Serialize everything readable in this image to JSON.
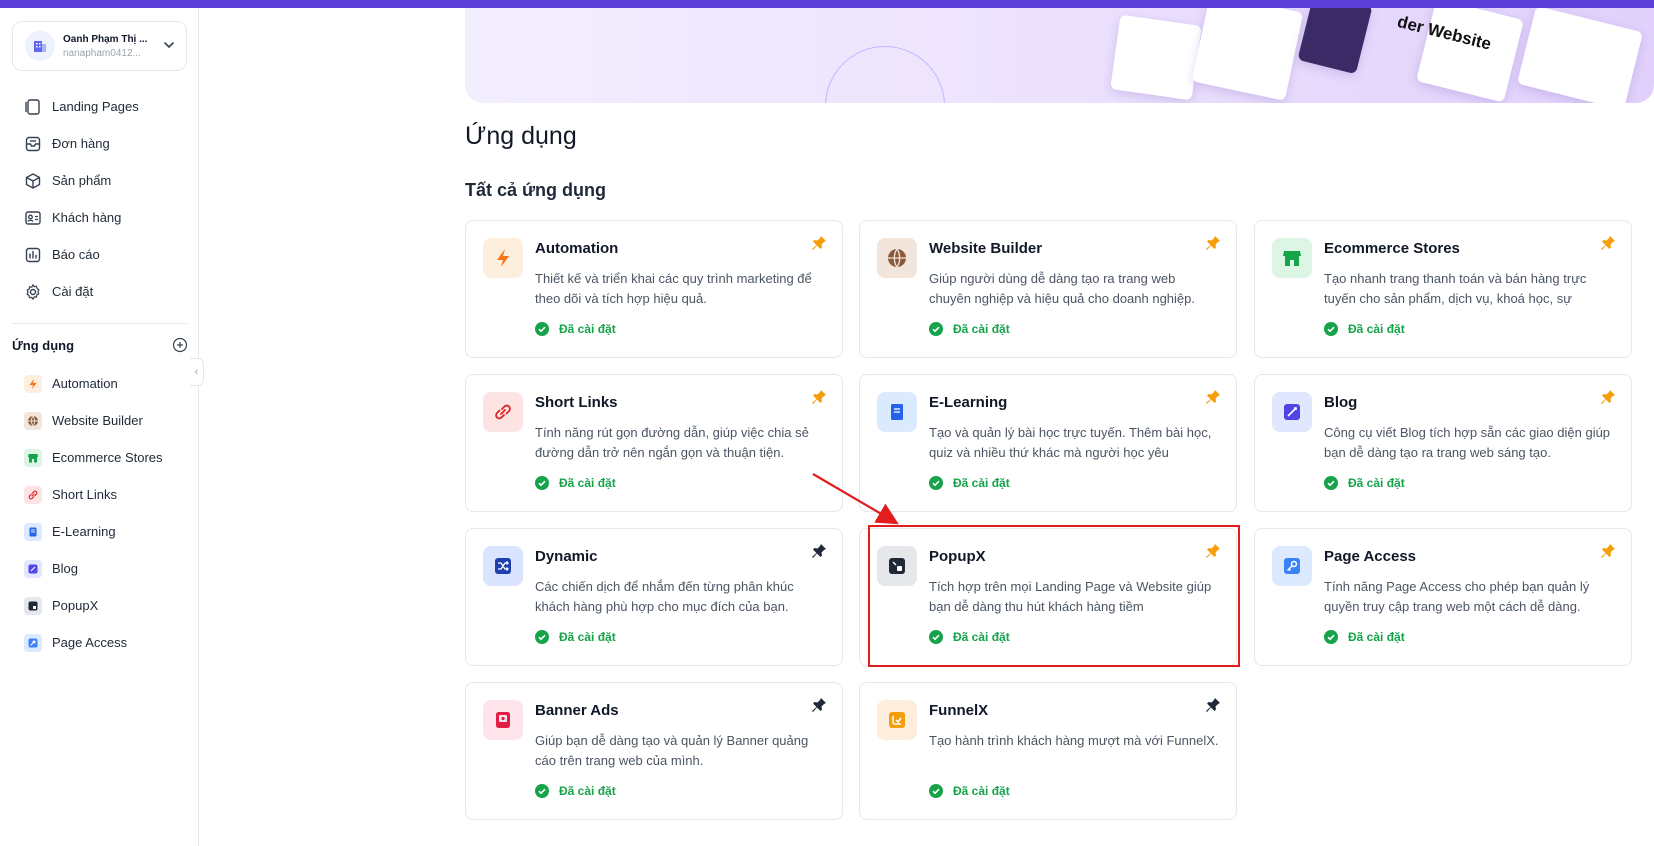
{
  "account": {
    "name": "Oanh Phạm Thị ...",
    "email": "nanapham0412..."
  },
  "nav": [
    {
      "label": "Landing Pages",
      "icon": "landing-pages-icon"
    },
    {
      "label": "Đơn hàng",
      "icon": "orders-icon"
    },
    {
      "label": "Sản phẩm",
      "icon": "products-icon"
    },
    {
      "label": "Khách hàng",
      "icon": "customers-icon"
    },
    {
      "label": "Báo cáo",
      "icon": "reports-icon"
    },
    {
      "label": "Cài đặt",
      "icon": "settings-icon"
    }
  ],
  "apps_section": {
    "title": "Ứng dụng"
  },
  "sidebar_apps": [
    {
      "label": "Automation",
      "icon": "automation-icon"
    },
    {
      "label": "Website Builder",
      "icon": "website-builder-icon"
    },
    {
      "label": "Ecommerce Stores",
      "icon": "ecommerce-icon"
    },
    {
      "label": "Short Links",
      "icon": "short-links-icon"
    },
    {
      "label": "E-Learning",
      "icon": "elearning-icon"
    },
    {
      "label": "Blog",
      "icon": "blog-icon"
    },
    {
      "label": "PopupX",
      "icon": "popupx-icon"
    },
    {
      "label": "Page Access",
      "icon": "page-access-icon"
    }
  ],
  "hero": {
    "title": "der Website"
  },
  "page": {
    "title": "Ứng dụng",
    "section": "Tất cả ứng dụng"
  },
  "status_label": "Đã cài đặt",
  "cards": [
    {
      "title": "Automation",
      "desc": "Thiết kế và triển khai các quy trình marketing để theo dõi và tích hợp hiệu quả.",
      "icon": "automation-icon",
      "pinned": true
    },
    {
      "title": "Website Builder",
      "desc": "Giúp người dùng dễ dàng tạo ra trang web chuyên nghiệp và hiệu quả cho doanh nghiệp.",
      "icon": "website-builder-icon",
      "pinned": true
    },
    {
      "title": "Ecommerce Stores",
      "desc": "Tạo nhanh trang thanh toán và bán hàng trực tuyến cho sản phẩm, dịch vụ, khoá học, sự",
      "icon": "ecommerce-icon",
      "pinned": true
    },
    {
      "title": "Short Links",
      "desc": "Tính năng rút gọn đường dẫn, giúp việc chia sẻ đường dẫn trở nên ngắn gọn và thuận tiện.",
      "icon": "short-links-icon",
      "pinned": true
    },
    {
      "title": "E-Learning",
      "desc": "Tạo và quản lý bài học trực tuyến. Thêm bài học, quiz và nhiều thứ khác mà người học yêu",
      "icon": "elearning-icon",
      "pinned": true
    },
    {
      "title": "Blog",
      "desc": "Công cụ viết Blog tích hợp sẵn các giao diện giúp bạn dễ dàng tạo ra trang web sáng tạo.",
      "icon": "blog-icon",
      "pinned": true
    },
    {
      "title": "Dynamic",
      "desc": "Các chiến dịch để nhắm đến từng phân khúc khách hàng phù hợp cho mục đích của bạn.",
      "icon": "dynamic-icon",
      "pinned": false
    },
    {
      "title": "PopupX",
      "desc": "Tích hợp trên mọi Landing Page và Website giúp bạn dễ dàng thu hút khách hàng tiềm",
      "icon": "popupx-icon",
      "pinned": true
    },
    {
      "title": "Page Access",
      "desc": "Tính năng Page Access cho phép bạn quản lý quyền truy cập trang web một cách dễ dàng.",
      "icon": "page-access-icon",
      "pinned": true
    },
    {
      "title": "Banner Ads",
      "desc": "Giúp bạn dễ dàng tạo và quản lý Banner quảng cáo trên trang web của mình.",
      "icon": "banner-ads-icon",
      "pinned": false
    },
    {
      "title": "FunnelX",
      "desc": "Tạo hành trình khách hàng mượt mà với FunnelX.",
      "icon": "funnelx-icon",
      "pinned": false
    }
  ],
  "colors": {
    "accent": "#5b3fd6",
    "installed": "#16a34a",
    "pin_active": "#f59e0b",
    "pin_inactive": "#1f2937",
    "highlight": "#e11d1d"
  }
}
